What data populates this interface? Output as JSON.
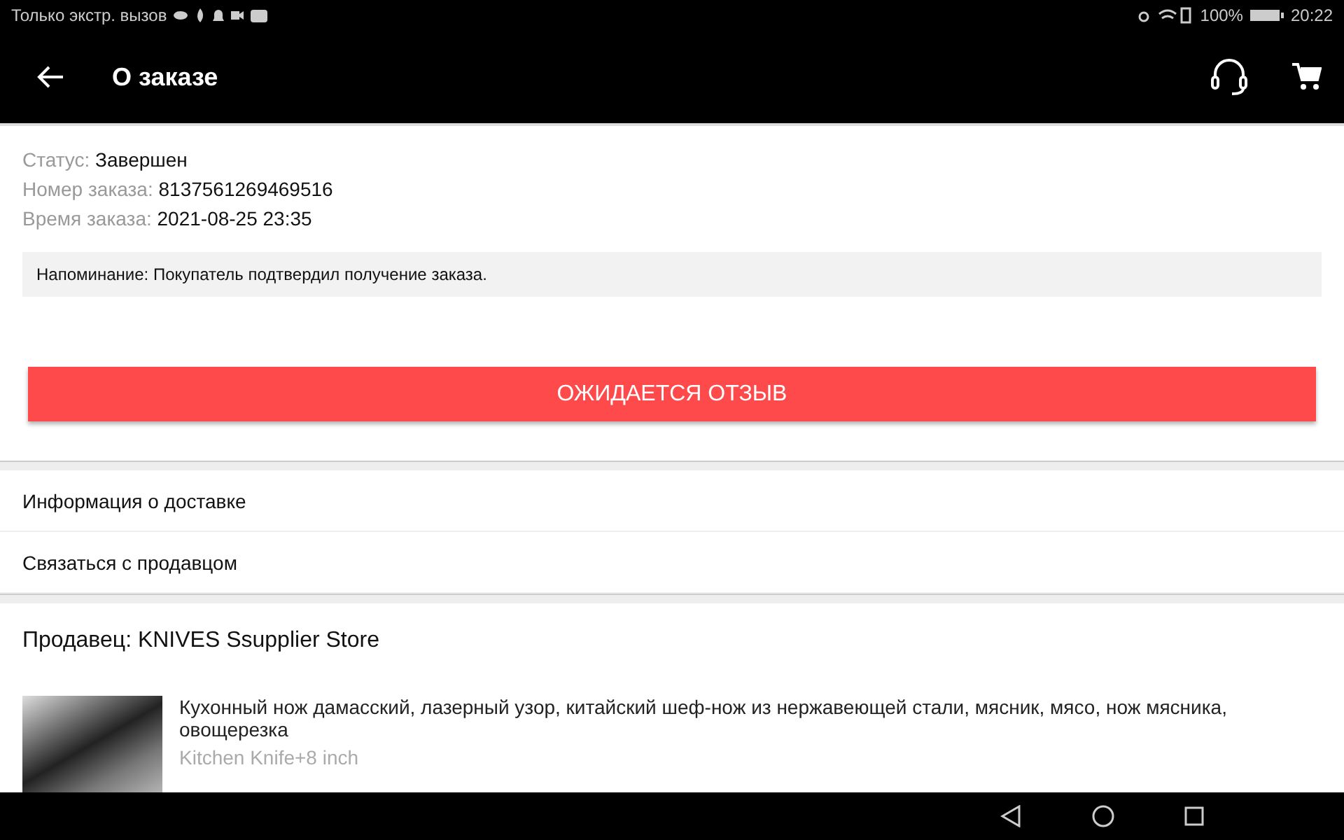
{
  "status_bar": {
    "carrier": "Только экстр. вызов",
    "battery": "100%",
    "time": "20:22"
  },
  "app_bar": {
    "title": "О заказе"
  },
  "order": {
    "fields": [
      {
        "label": "Статус:",
        "value": "Завершен"
      },
      {
        "label": "Номер заказа:",
        "value": "8137561269469516"
      },
      {
        "label": "Время заказа:",
        "value": "2021-08-25 23:35"
      }
    ],
    "reminder": "Напоминание: Покупатель подтвердил получение заказа.",
    "action_button": "ОЖИДАЕТСЯ ОТЗЫВ"
  },
  "links": [
    "Информация о доставке",
    "Связаться с продавцом"
  ],
  "seller": "Продавец: KNIVES Ssupplier Store",
  "product": {
    "title": "Кухонный нож дамасский, лазерный узор, китайский шеф-нож из нержавеющей стали, мясник, мясо, нож мясника, овощерезка",
    "variant": "Kitchen Knife+8 inch"
  }
}
